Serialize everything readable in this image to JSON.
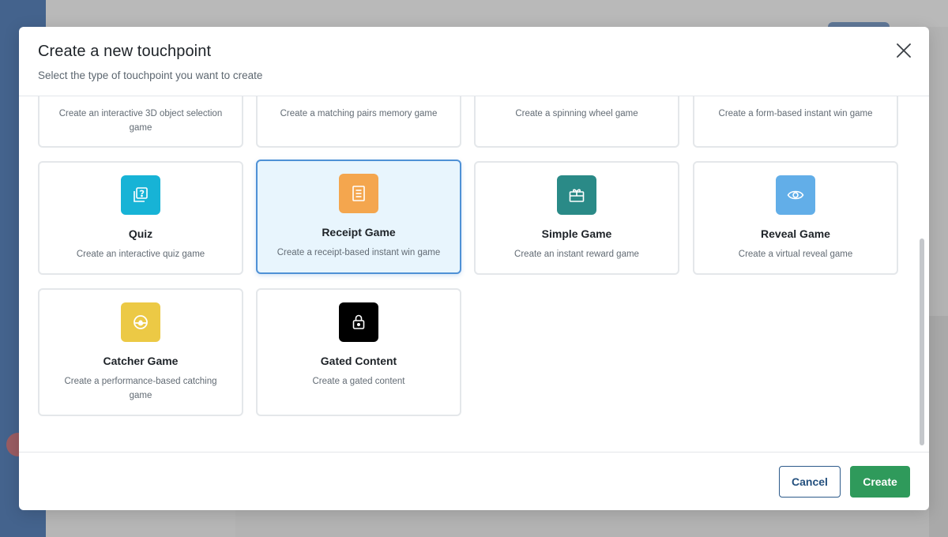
{
  "dialog": {
    "title": "Create a new touchpoint",
    "subtitle": "Select the type of touchpoint you want to create"
  },
  "cards": [
    {
      "title": "",
      "desc": "Create an interactive 3D object selection game",
      "icon": "none",
      "color": ""
    },
    {
      "title": "",
      "desc": "Create a matching pairs memory game",
      "icon": "none",
      "color": ""
    },
    {
      "title": "",
      "desc": "Create a spinning wheel game",
      "icon": "none",
      "color": ""
    },
    {
      "title": "",
      "desc": "Create a form-based instant win game",
      "icon": "none",
      "color": ""
    },
    {
      "title": "Quiz",
      "desc": "Create an interactive quiz game",
      "icon": "quiz-icon",
      "color": "#17b3d6"
    },
    {
      "title": "Receipt Game",
      "desc": "Create a receipt-based instant win game",
      "icon": "receipt-icon",
      "color": "#f4a64e",
      "selected": true
    },
    {
      "title": "Simple Game",
      "desc": "Create an instant reward game",
      "icon": "gift-icon",
      "color": "#2a8a87"
    },
    {
      "title": "Reveal Game",
      "desc": "Create a virtual reveal game",
      "icon": "eye-icon",
      "color": "#62aee8"
    },
    {
      "title": "Catcher Game",
      "desc": "Create a performance-based catching game",
      "icon": "catcher-icon",
      "color": "#ecc945"
    },
    {
      "title": "Gated Content",
      "desc": "Create a gated content",
      "icon": "lock-icon",
      "color": "#000000"
    }
  ],
  "footer": {
    "cancel_label": "Cancel",
    "create_label": "Create"
  },
  "colors": {
    "selected_border": "#4f91d6",
    "selected_bg": "#e8f5fd",
    "create_button": "#2f9a5b",
    "cancel_border": "#2c5a8a"
  }
}
